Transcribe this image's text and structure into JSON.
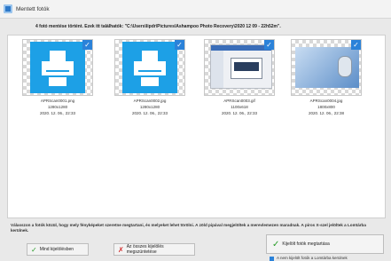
{
  "window": {
    "title": "Mentett fotók"
  },
  "info_message": "4 fotó mentése történt. Ezek itt találhatók: \"C:\\Users\\lipdr\\Pictures\\Ashampoo Photo Recovery\\2020 12 09 - 22h52m\".",
  "files": [
    {
      "name": "APRScan0001.png",
      "dimensions": "1280x1280",
      "date": "2020. 12. 06., 22:33",
      "checked": true,
      "preview": "printer-icon"
    },
    {
      "name": "APRScan0002.jpg",
      "dimensions": "1280x1280",
      "date": "2020. 12. 06., 22:33",
      "checked": true,
      "preview": "printer-icon"
    },
    {
      "name": "APRScan0003.gif",
      "dimensions": "1100x618",
      "date": "2020. 12. 06., 22:33",
      "checked": true,
      "preview": "screenshot"
    },
    {
      "name": "APRScan0004.jpg",
      "dimensions": "1800x800",
      "date": "2020. 12. 06., 22:38",
      "checked": true,
      "preview": "photo"
    }
  ],
  "instructions": "Válasszon a fotók közül, hogy mely fényképeket szeretne megtartani, és melyeket lehet törölni. A zöld pipával megjelöltek a merevlemezen maradnak. A piros X-szel jelöltek a Lomtárba kerülnek.",
  "buttons": {
    "select_all": "Mind kijelölésben",
    "deselect_all": "Az összes kijelölés megszüntetése",
    "keep_selected": "Kijelölt fotók megtartása",
    "hidden_option": "A nem kijelölt fotók a Lomtárba kerülnek"
  },
  "colors": {
    "accent": "#2b82d9",
    "check_green": "#2a9d2a",
    "x_red": "#d12a2a",
    "printer_blue": "#1da0e6"
  }
}
